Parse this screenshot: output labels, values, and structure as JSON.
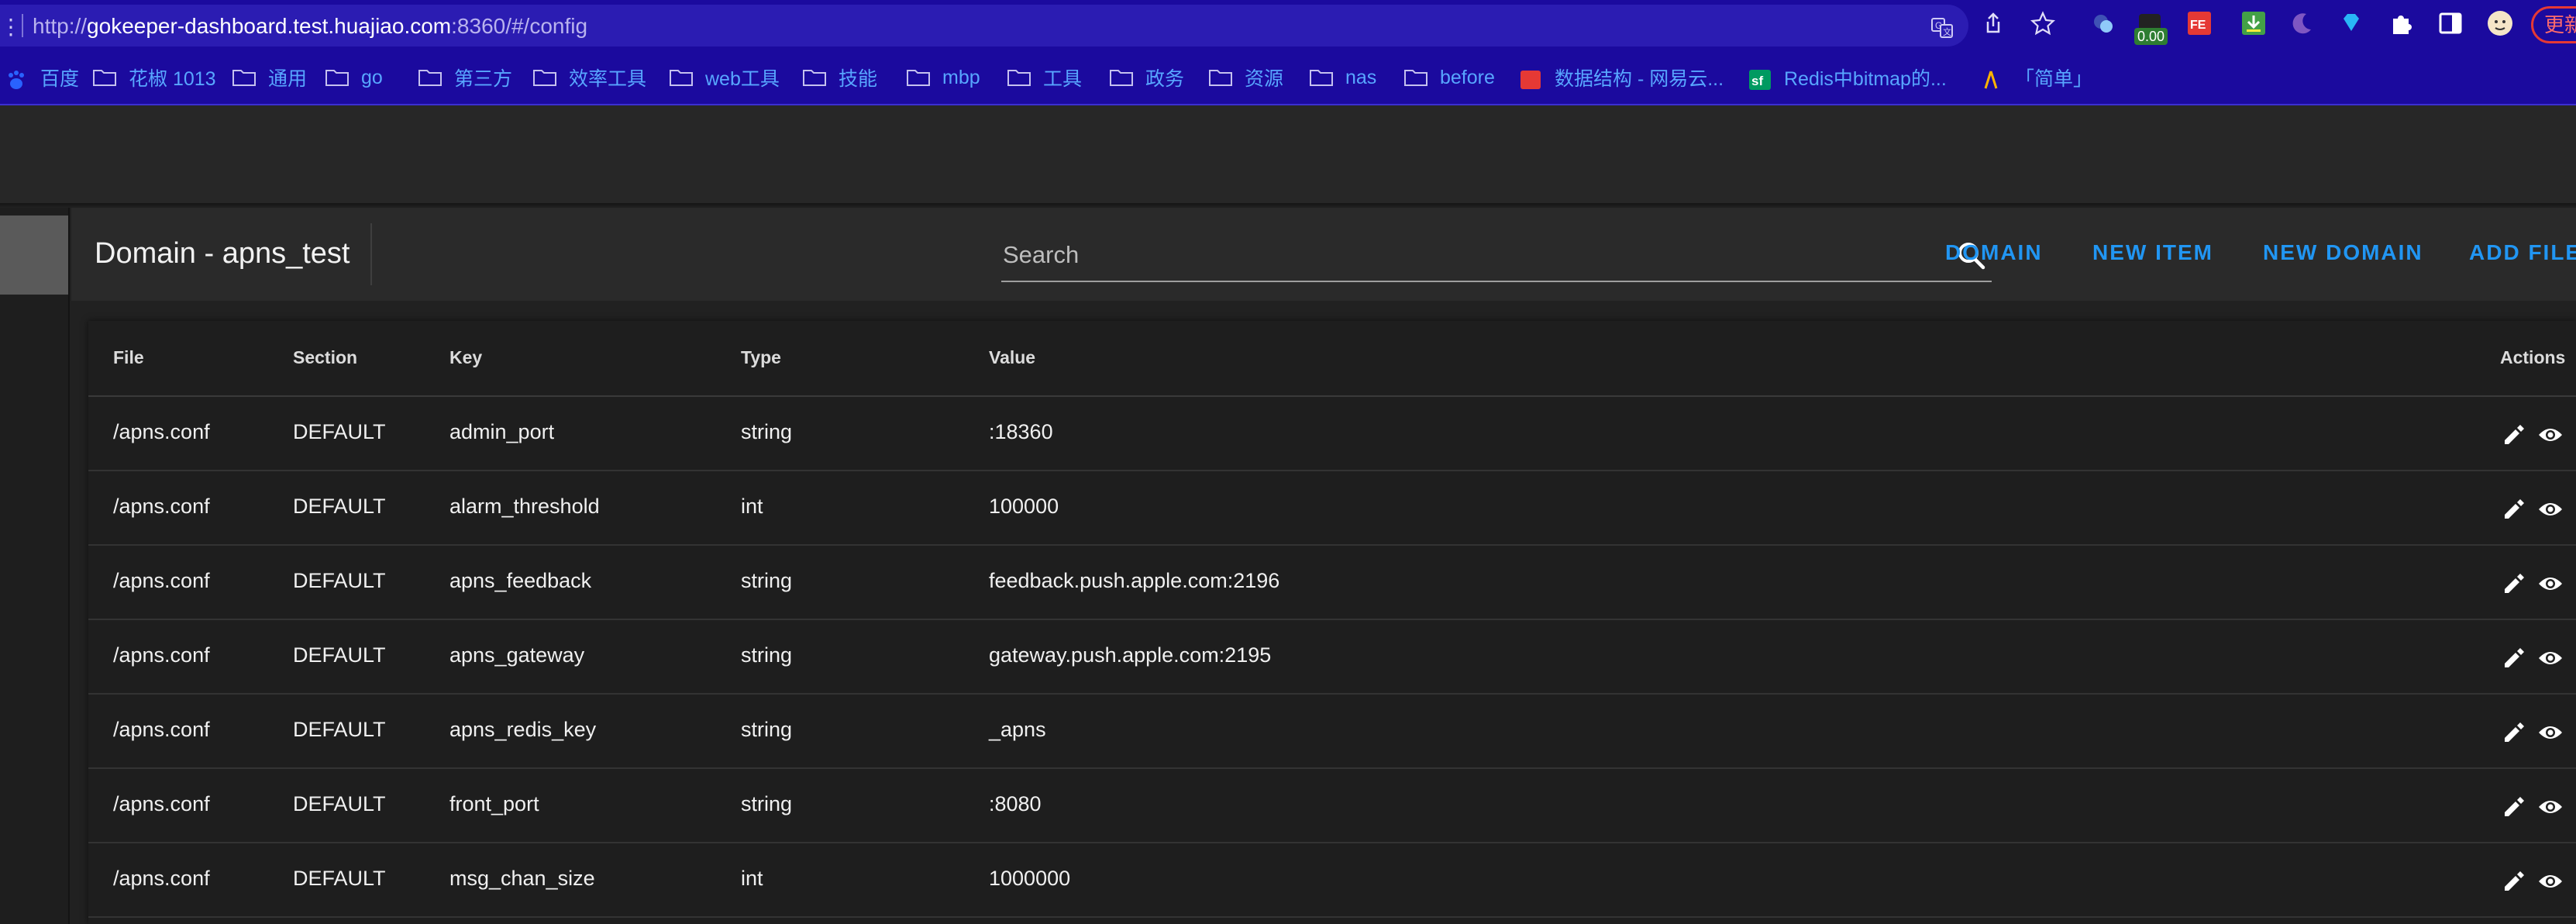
{
  "browser": {
    "url_prefix": "http://",
    "url_host": "gokeeper-dashboard.test.huajiao.com",
    "url_suffix": ":8360/#/config",
    "extension_badge": "0.00",
    "update_label": "更新",
    "bookmarks": [
      {
        "label": "百度",
        "icon": "baidu-icon"
      },
      {
        "label": "花椒 1013",
        "icon": "folder-icon"
      },
      {
        "label": "通用",
        "icon": "folder-icon"
      },
      {
        "label": "go",
        "icon": "folder-icon"
      },
      {
        "label": "第三方",
        "icon": "folder-icon"
      },
      {
        "label": "效率工具",
        "icon": "folder-icon"
      },
      {
        "label": "web工具",
        "icon": "folder-icon"
      },
      {
        "label": "技能",
        "icon": "folder-icon"
      },
      {
        "label": "mbp",
        "icon": "folder-icon"
      },
      {
        "label": "工具",
        "icon": "folder-icon"
      },
      {
        "label": "政务",
        "icon": "folder-icon"
      },
      {
        "label": "资源",
        "icon": "folder-icon"
      },
      {
        "label": "nas",
        "icon": "folder-icon"
      },
      {
        "label": "before",
        "icon": "folder-icon"
      },
      {
        "label": "数据结构 - 网易云...",
        "icon": "netease-icon"
      },
      {
        "label": "Redis中bitmap的...",
        "icon": "segmentfault-icon"
      },
      {
        "label": "「简单」",
        "icon": "jianshu-icon"
      }
    ]
  },
  "toolbar": {
    "title": "Domain - apns_test",
    "search_placeholder": "Search",
    "buttons": [
      "DOMAIN",
      "NEW ITEM",
      "NEW DOMAIN",
      "ADD FILE"
    ]
  },
  "table": {
    "headers": [
      "File",
      "Section",
      "Key",
      "Type",
      "Value",
      "Actions"
    ],
    "rows": [
      [
        "/apns.conf",
        "DEFAULT",
        "admin_port",
        "string",
        ":18360"
      ],
      [
        "/apns.conf",
        "DEFAULT",
        "alarm_threshold",
        "int",
        "100000"
      ],
      [
        "/apns.conf",
        "DEFAULT",
        "apns_feedback",
        "string",
        "feedback.push.apple.com:2196"
      ],
      [
        "/apns.conf",
        "DEFAULT",
        "apns_gateway",
        "string",
        "gateway.push.apple.com:2195"
      ],
      [
        "/apns.conf",
        "DEFAULT",
        "apns_redis_key",
        "string",
        "_apns"
      ],
      [
        "/apns.conf",
        "DEFAULT",
        "front_port",
        "string",
        ":8080"
      ],
      [
        "/apns.conf",
        "DEFAULT",
        "msg_chan_size",
        "int",
        "1000000"
      ]
    ]
  },
  "colors": {
    "accent": "#2196f3",
    "browser_bar": "#1b0a9e",
    "app_background": "#212121"
  }
}
